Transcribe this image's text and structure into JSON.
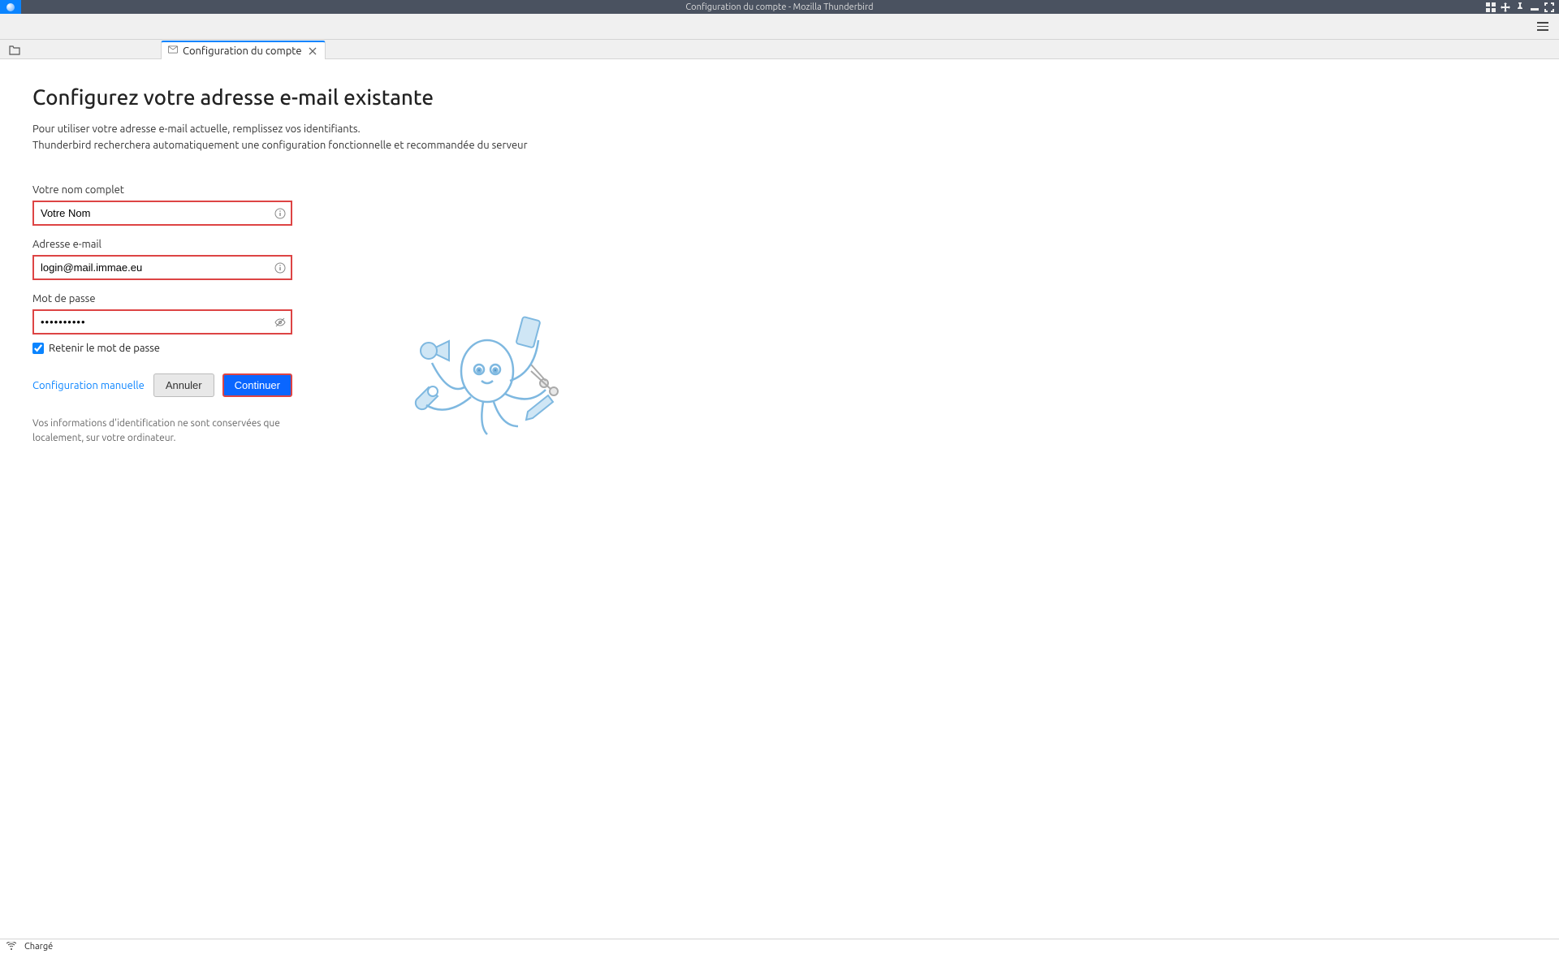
{
  "window": {
    "title": "Configuration du compte - Mozilla Thunderbird"
  },
  "tabs": {
    "active": {
      "label": "Configuration du compte"
    }
  },
  "page": {
    "title": "Configurez votre adresse e-mail existante",
    "subtitle_line1": "Pour utiliser votre adresse e-mail actuelle, remplissez vos identifiants.",
    "subtitle_line2": "Thunderbird recherchera automatiquement une configuration fonctionnelle et recommandée du serveur"
  },
  "form": {
    "name": {
      "label": "Votre nom complet",
      "value": "Votre Nom"
    },
    "email": {
      "label": "Adresse e-mail",
      "value": "login@mail.immae.eu"
    },
    "password": {
      "label": "Mot de passe",
      "value": "••••••••••"
    },
    "remember": {
      "label": "Retenir le mot de passe",
      "checked": true
    }
  },
  "actions": {
    "manual_config": "Configuration manuelle",
    "cancel": "Annuler",
    "continue": "Continuer"
  },
  "disclaimer": "Vos informations d'identification ne sont conservées que localement, sur votre ordinateur.",
  "status": {
    "text": "Chargé"
  }
}
